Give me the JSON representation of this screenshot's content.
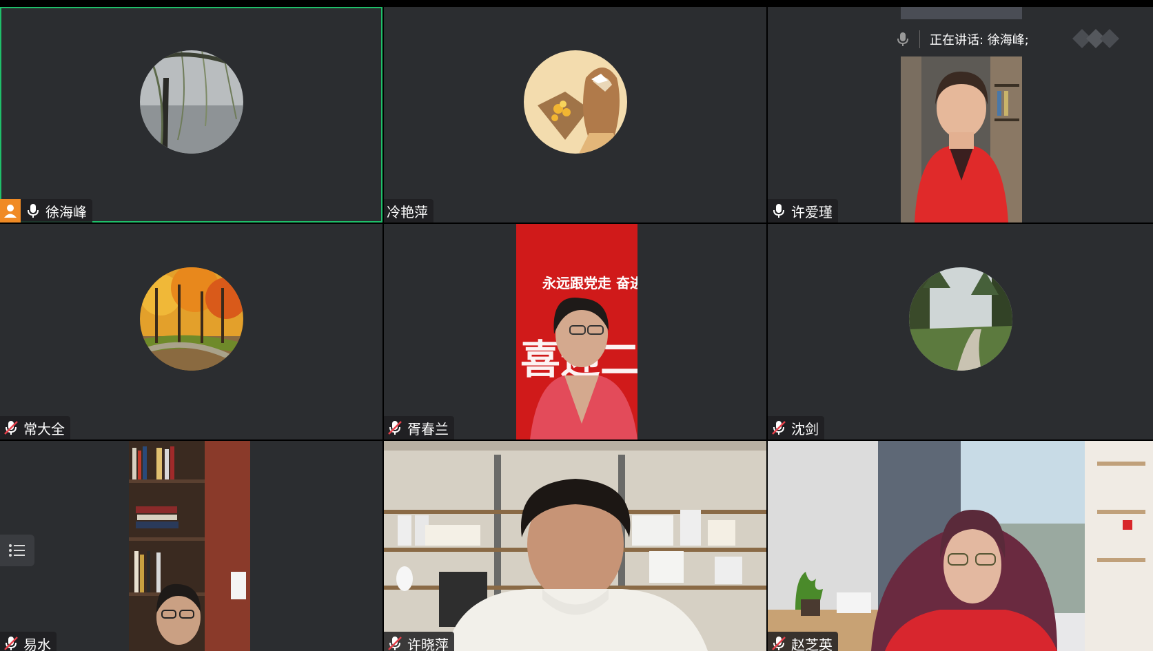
{
  "app": {
    "speaking_label": "正在讲话: 徐海峰;",
    "colors": {
      "tile_bg": "#2b2d30",
      "active_border": "#1fbf6a",
      "host_badge": "#f08a24",
      "muted_icon": "#e8404a"
    }
  },
  "participants": [
    {
      "name": "徐海峰",
      "mic": "on",
      "host": true,
      "active": true,
      "media": "avatar-willow-lake"
    },
    {
      "name": "冷艳萍",
      "mic": "none",
      "host": false,
      "media": "avatar-cartoon-girl-bouquet"
    },
    {
      "name": "许爱瑾",
      "mic": "on",
      "host": false,
      "media": "video-woman-red-cardigan"
    },
    {
      "name": "常大全",
      "mic": "muted",
      "host": false,
      "media": "avatar-autumn-forest"
    },
    {
      "name": "胥春兰",
      "mic": "muted",
      "host": false,
      "media": "video-woman-red-banner",
      "banner_text": "永远跟党走 奋进新征",
      "banner_big": "喜迎二十"
    },
    {
      "name": "沈剑",
      "mic": "muted",
      "host": false,
      "media": "avatar-forest-path"
    },
    {
      "name": "易水",
      "mic": "muted",
      "host": false,
      "media": "video-man-bookshelf"
    },
    {
      "name": "许晓萍",
      "mic": "muted",
      "host": false,
      "media": "video-woman-shelves"
    },
    {
      "name": "赵芝英",
      "mic": "muted",
      "host": false,
      "media": "video-woman-window"
    }
  ]
}
